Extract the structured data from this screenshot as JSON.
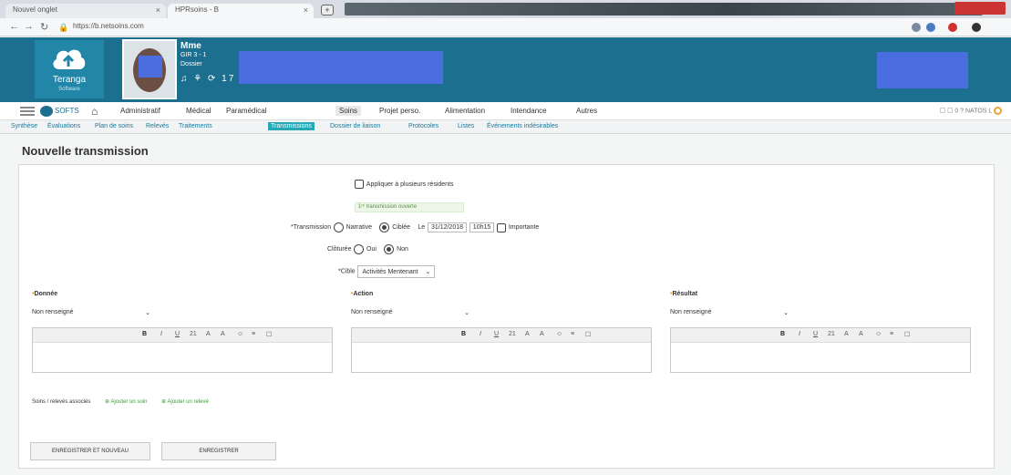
{
  "browser": {
    "tabs": [
      {
        "label": "Nouvel onglet",
        "close": "×"
      },
      {
        "label": "HPRsoins - B",
        "close": "×"
      }
    ],
    "new_tab": "+",
    "url": "https://b.netsoins.com"
  },
  "header": {
    "logo_name": "Teranga",
    "logo_sub": "Software",
    "patient": {
      "name": "Mme",
      "line1": "GIR 3 - 1",
      "line2": "Dossier",
      "icons": "♫ ⚘ ⟳ 17 ☘ ☛"
    }
  },
  "menubar": {
    "brand": "SOFTS",
    "items": [
      "Administratif",
      "Médical",
      "Paramédical",
      "Soins",
      "Projet perso.",
      "Alimentation",
      "Intendance",
      "Autres"
    ],
    "active_index": 3,
    "user": "☐ ☐ 0 ? NATOS L"
  },
  "subnav": {
    "items": [
      "Synthèse",
      "Évaluations",
      "Plan de soins",
      "Relevés",
      "Traitements",
      "Transmissions",
      "Dossier de liaison",
      "Protocoles",
      "Listes",
      "Événements indésirables"
    ],
    "active_index": 5
  },
  "page": {
    "title": "Nouvelle transmission"
  },
  "form": {
    "apply_multiple": "Appliquer à plusieurs résidents",
    "notice": "1ʳᵉ transmission ouverte",
    "transmission_label": "*Transmission",
    "opt_narrative": "Narrative",
    "opt_ciblee": "Ciblée",
    "date_label": "Le",
    "date_value": "31/12/2018",
    "time_value": "10h15",
    "important": "Importante",
    "cloturee_label": "Clôturée",
    "oui": "Oui",
    "non": "Non",
    "cible_label": "*Cible",
    "cible_value": "Activités Mentenant",
    "columns": [
      {
        "label": "Donnée",
        "select": "Non renseigné"
      },
      {
        "label": "Action",
        "select": "Non renseigné"
      },
      {
        "label": "Résultat",
        "select": "Non renseigné"
      }
    ],
    "toolbar": [
      "B",
      "I",
      "U",
      "21",
      "A",
      "A",
      "☺",
      "≡",
      "☐"
    ],
    "links_label": "Soins / relevés associés",
    "add_care": "Ajouter un soin",
    "add_reading": "Ajouter un relevé",
    "btn_save_new": "ENREGISTRER ET NOUVEAU",
    "btn_save": "ENREGISTRER"
  },
  "colors": {
    "header_bg": "#1d6f8f",
    "redaction": "#4a6ee0",
    "subnav_active": "#26a8b5",
    "link_green": "#3a9a3a"
  }
}
